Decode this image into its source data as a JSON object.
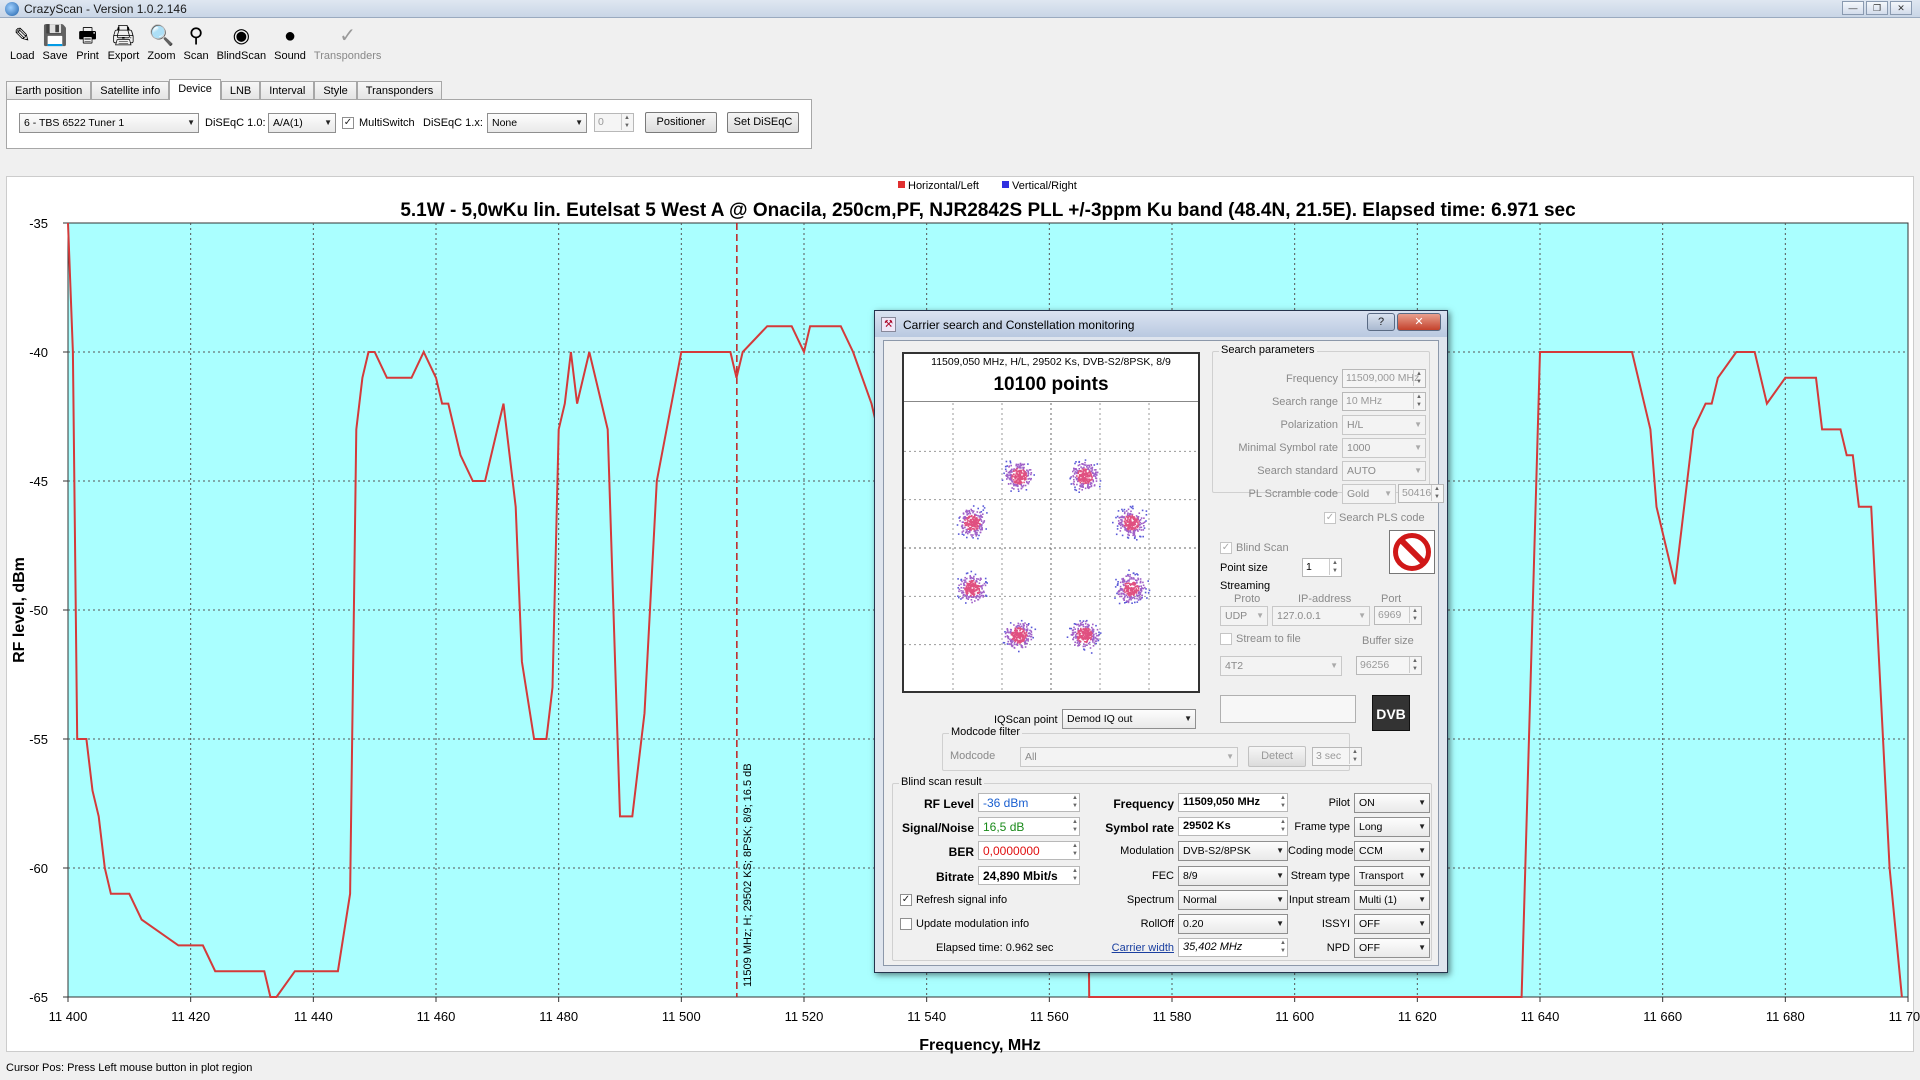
{
  "window": {
    "title": "CrazyScan - Version 1.0.2.146",
    "controls": [
      "—",
      "❐",
      "✕"
    ]
  },
  "toolbar": [
    {
      "label": "Load",
      "icon": "load-icon",
      "glyph": "✎"
    },
    {
      "label": "Save",
      "icon": "save-icon",
      "glyph": "💾"
    },
    {
      "label": "Print",
      "icon": "print-icon",
      "glyph": "🖶"
    },
    {
      "label": "Export",
      "icon": "export-icon",
      "glyph": "🖨"
    },
    {
      "label": "Zoom",
      "icon": "zoom-icon",
      "glyph": "🔍"
    },
    {
      "label": "Scan",
      "icon": "scan-icon",
      "glyph": "⚲"
    },
    {
      "label": "BlindScan",
      "icon": "blindscan-icon",
      "glyph": "◉"
    },
    {
      "label": "Sound",
      "icon": "sound-icon",
      "glyph": "●"
    },
    {
      "label": "Transponders",
      "icon": "transponders-icon",
      "glyph": "✓"
    }
  ],
  "tabs": [
    "Earth position",
    "Satellite info",
    "Device",
    "LNB",
    "Interval",
    "Style",
    "Transponders"
  ],
  "active_tab": "Device",
  "device": {
    "tuner": "6 - TBS 6522 Tuner 1",
    "diseqc10_label": "DiSEqC 1.0:",
    "diseqc10_value": "A/A(1)",
    "multiswitch_label": "MultiSwitch",
    "diseqc1x_label": "DiSEqC 1.x:",
    "diseqc1x_value": "None",
    "diseqc1x_number": "0",
    "positioner_button": "Positioner",
    "set_diseqc_button": "Set DiSEqC"
  },
  "colors": {
    "plot_bg": "#aaffff",
    "trace": "#d43a3a",
    "vertical_series": "#3a3ae0"
  },
  "chart_data": {
    "type": "line",
    "title": "5.1W - 5,0wKu lin. Eutelsat 5 West A @ Onacila, 250cm,PF, NJR2842S PLL +/-3ppm Ku band (48.4N, 21.5E). Elapsed time: 6.971 sec",
    "xlabel": "Frequency, MHz",
    "ylabel": "RF level, dBm",
    "xlim": [
      11400,
      11700
    ],
    "ylim": [
      -65,
      -35
    ],
    "x_ticks": [
      11400,
      11420,
      11440,
      11460,
      11480,
      11500,
      11520,
      11540,
      11560,
      11580,
      11600,
      11620,
      11640,
      11660,
      11680,
      11700
    ],
    "x_tick_labels": [
      "11 400",
      "11 420",
      "11 440",
      "11 460",
      "11 480",
      "11 500",
      "11 520",
      "11 540",
      "11 560",
      "11 580",
      "11 600",
      "11 620",
      "11 640",
      "11 660",
      "11 680",
      "11 700"
    ],
    "y_ticks": [
      -35,
      -40,
      -45,
      -50,
      -55,
      -60,
      -65
    ],
    "y_tick_labels": [
      "-35",
      "-40",
      "-45",
      "-50",
      "-55",
      "-60",
      "-65"
    ],
    "grid": true,
    "legend": [
      {
        "name": "Horizontal/Left",
        "color": "#e03030"
      },
      {
        "name": "Vertical/Right",
        "color": "#3030e0"
      }
    ],
    "legend_position": "top-center",
    "marker": {
      "x": 11509.05,
      "label": "11509 MHz; H; 29502 KS; 8PSK; 8/9; 16.5 dB"
    },
    "series": [
      {
        "name": "Horizontal/Left",
        "x": [
          11400,
          11400.8,
          11401.5,
          11403,
          11404,
          11405,
          11406,
          11407,
          11410,
          11412,
          11418,
          11419,
          11422,
          11424,
          11432,
          11433,
          11434,
          11437,
          11438,
          11444,
          11446,
          11447,
          11448,
          11449,
          11450,
          11452,
          11456,
          11458,
          11460,
          11461,
          11462,
          11464,
          11466,
          11468,
          11470,
          11471,
          11472,
          11473,
          11474,
          11476,
          11478,
          11479,
          11480,
          11481,
          11482,
          11483,
          11485,
          11487,
          11488,
          11490,
          11492,
          11494,
          11496,
          11500,
          11504,
          11505,
          11506,
          11508,
          11509,
          11510,
          11514,
          11515,
          11516,
          11518,
          11520,
          11521,
          11523,
          11526,
          11528,
          11531,
          11533,
          11535,
          11535.5,
          11564.5,
          11566,
          11566.5,
          11637,
          11640,
          11642,
          11650,
          11652,
          11655,
          11658,
          11659,
          11661,
          11662,
          11663,
          11665,
          11667,
          11668,
          11669,
          11672,
          11675,
          11676,
          11677,
          11680,
          11685,
          11686,
          11687,
          11689,
          11690,
          11691,
          11692,
          11694,
          11697,
          11699
        ],
        "values": [
          -35,
          -40,
          -55,
          -55,
          -57,
          -58,
          -60,
          -61,
          -61,
          -62,
          -63,
          -63,
          -63,
          -64,
          -64,
          -65,
          -65,
          -64,
          -64,
          -64,
          -61,
          -43,
          -41,
          -40,
          -40,
          -41,
          -41,
          -40,
          -41,
          -42,
          -42,
          -44,
          -45,
          -45,
          -43,
          -42,
          -44,
          -46,
          -52,
          -55,
          -55,
          -53,
          -43,
          -42,
          -40,
          -42,
          -40,
          -42,
          -43,
          -58,
          -58,
          -54,
          -45,
          -40,
          -40,
          -40,
          -40,
          -40,
          -41,
          -40,
          -39,
          -39,
          -39,
          -39,
          -40,
          -39,
          -39,
          -39,
          -40,
          -42,
          -44,
          -46,
          -48,
          -48,
          -48,
          -65,
          -65,
          -40,
          -40,
          -40,
          -40,
          -40,
          -43,
          -46,
          -48,
          -49,
          -47,
          -43,
          -42,
          -42,
          -41,
          -40,
          -40,
          -41,
          -42,
          -41,
          -41,
          -43,
          -43,
          -43,
          -44,
          -44,
          -46,
          -46,
          -60,
          -65
        ]
      }
    ]
  },
  "status": "Cursor Pos: Press Left mouse button in plot region",
  "dialog": {
    "title": "Carrier search and Constellation monitoring",
    "help_button": "?",
    "close_button": "✕",
    "constellation": {
      "caption": "11509,050 MHz, H/L, 29502 Ks, DVB-S2/8PSK, 8/9",
      "points_text": "10100 points"
    },
    "search_params": {
      "group_title": "Search parameters",
      "frequency_label": "Frequency",
      "frequency": "11509,000 MHz",
      "search_range_label": "Search range",
      "search_range": "10 MHz",
      "polarization_label": "Polarization",
      "polarization": "H/L",
      "min_sr_label": "Minimal Symbol rate",
      "min_sr": "1000",
      "search_std_label": "Search standard",
      "search_std": "AUTO",
      "pl_scramble_label": "PL Scramble code",
      "pl_scramble": "Gold",
      "pl_scramble_num": "50416",
      "search_pls_label": "Search PLS code"
    },
    "blind_scan_label": "Blind Scan",
    "point_size_label": "Point size",
    "point_size": "1",
    "streaming": {
      "title": "Streaming",
      "proto_label": "Proto",
      "ip_label": "IP-address",
      "port_label": "Port",
      "proto": "UDP",
      "ip": "127.0.0.1",
      "port": "6969",
      "stream_to_file_label": "Stream to file",
      "buffer_label": "Buffer size",
      "file_value": "4T2",
      "buffer": "96256"
    },
    "iqscan_label": "IQScan point",
    "iqscan_value": "Demod IQ out",
    "dvb_logo": "DVB",
    "modcode": {
      "group_title": "Modcode filter",
      "label": "Modcode",
      "value": "All",
      "detect_button": "Detect",
      "time": "3 sec"
    },
    "result": {
      "group_title": "Blind scan result",
      "rf_level_label": "RF Level",
      "rf_level": "-36 dBm",
      "snr_label": "Signal/Noise",
      "snr": "16,5 dB",
      "ber_label": "BER",
      "ber": "0,0000000",
      "bitrate_label": "Bitrate",
      "bitrate": "24,890 Mbit/s",
      "refresh_label": "Refresh signal info",
      "update_mod_label": "Update modulation info",
      "elapsed_label": "Elapsed time: 0.962 sec",
      "frequency_label": "Frequency",
      "frequency": "11509,050 MHz",
      "symbol_rate_label": "Symbol rate",
      "symbol_rate": "29502 Ks",
      "modulation_label": "Modulation",
      "modulation": "DVB-S2/8PSK",
      "fec_label": "FEC",
      "fec": "8/9",
      "spectrum_label": "Spectrum",
      "spectrum": "Normal",
      "rolloff_label": "RollOff",
      "rolloff": "0.20",
      "carrier_width_label": "Carrier width",
      "carrier_width": "35,402 MHz",
      "pilot_label": "Pilot",
      "pilot": "ON",
      "frame_type_label": "Frame type",
      "frame_type": "Long",
      "coding_mode_label": "Coding mode",
      "coding_mode": "CCM",
      "stream_type_label": "Stream type",
      "stream_type": "Transport",
      "input_stream_label": "Input stream",
      "input_stream": "Multi (1)",
      "issyi_label": "ISSYI",
      "issyi": "OFF",
      "npd_label": "NPD",
      "npd": "OFF"
    }
  }
}
